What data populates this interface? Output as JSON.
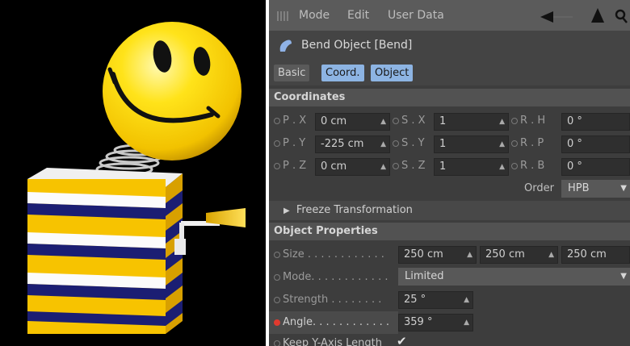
{
  "menu": {
    "mode": "Mode",
    "edit": "Edit",
    "user_data": "User Data"
  },
  "object": {
    "title": "Bend Object [Bend]"
  },
  "tabs": [
    {
      "label": "Basic",
      "active": false
    },
    {
      "label": "Coord.",
      "active": true
    },
    {
      "label": "Object",
      "active": true
    }
  ],
  "coordinates": {
    "heading": "Coordinates",
    "px": {
      "label": "P . X",
      "value": "0 cm"
    },
    "py": {
      "label": "P . Y",
      "value": "-225 cm"
    },
    "pz": {
      "label": "P . Z",
      "value": "0 cm"
    },
    "sx": {
      "label": "S . X",
      "value": "1"
    },
    "sy": {
      "label": "S . Y",
      "value": "1"
    },
    "sz": {
      "label": "S . Z",
      "value": "1"
    },
    "rh": {
      "label": "R . H",
      "value": "0 °"
    },
    "rp": {
      "label": "R . P",
      "value": "0 °"
    },
    "rb": {
      "label": "R . B",
      "value": "0 °"
    },
    "order_label": "Order",
    "order_value": "HPB"
  },
  "freeze": {
    "label": "Freeze Transformation"
  },
  "object_properties": {
    "heading": "Object Properties",
    "size": {
      "label": "Size . . . . . . . . . . . .",
      "values": [
        "250 cm",
        "250 cm",
        "250 cm"
      ]
    },
    "mode": {
      "label": "Mode. . . . . . . . . . . .",
      "value": "Limited"
    },
    "strength": {
      "label": "Strength . . . . . . . .",
      "value": "25 °"
    },
    "angle": {
      "label": "Angle. . . . . . . . . . . .",
      "value": "359 °"
    },
    "keep_y": {
      "label": "Keep Y-Axis Length",
      "checked": true
    }
  },
  "colors": {
    "accent_tab": "#8db4e3",
    "viewport_bg": "#000000",
    "panel_bg": "#3d3d3d",
    "keyframe_red": "#e03a2f"
  }
}
